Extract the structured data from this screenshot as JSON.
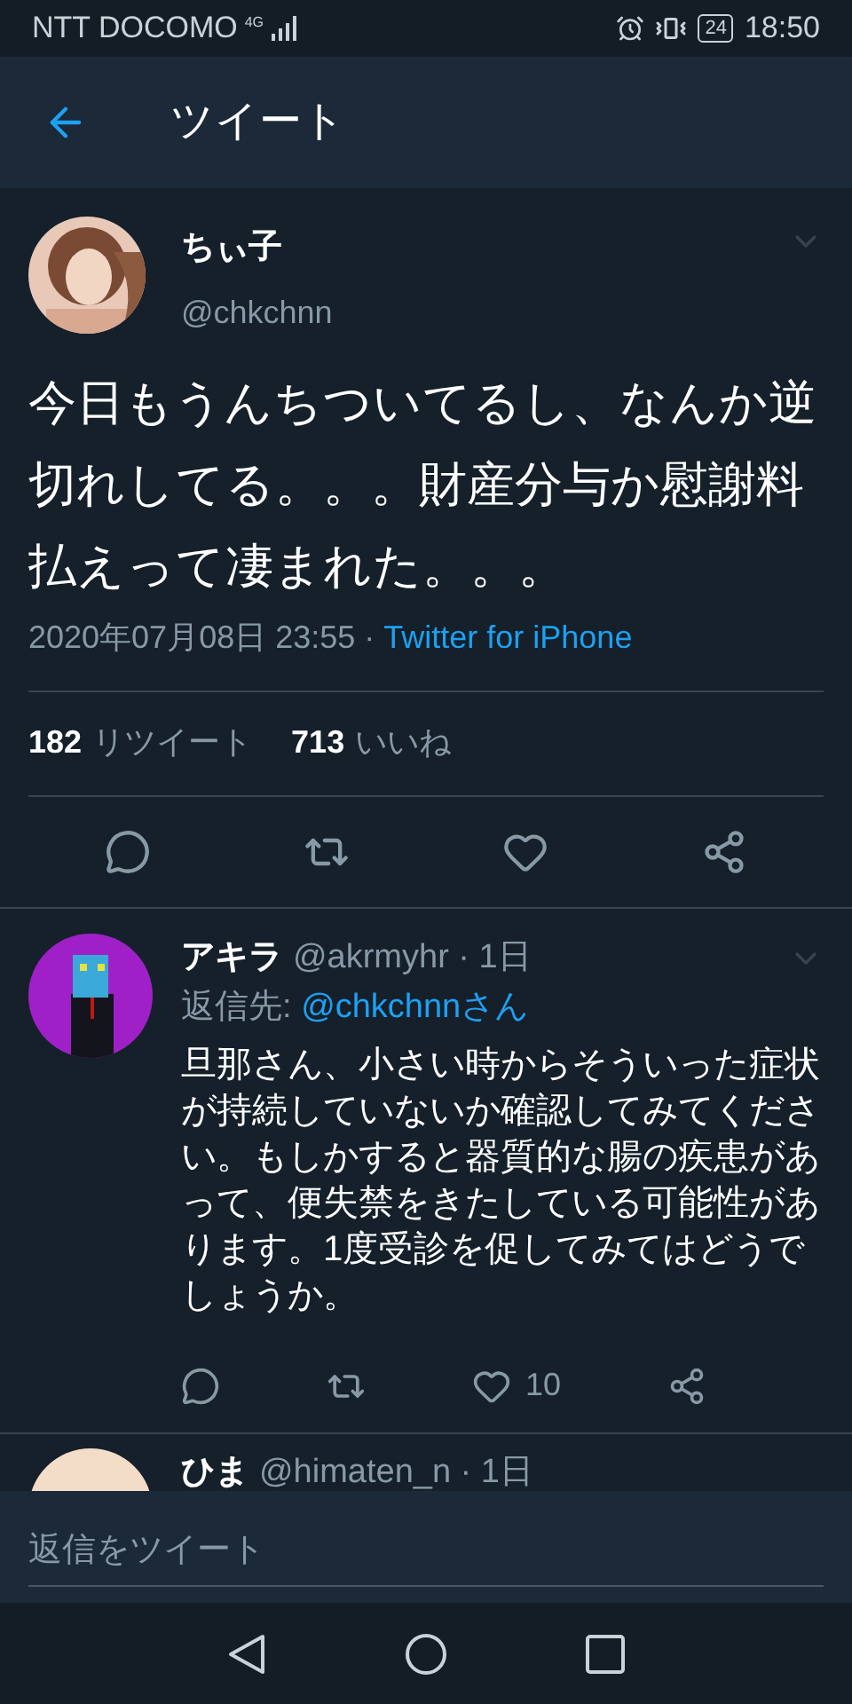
{
  "status_bar": {
    "carrier": "NTT DOCOMO",
    "network": "4G",
    "battery": "24",
    "time": "18:50"
  },
  "header": {
    "title": "ツイート"
  },
  "tweet": {
    "name": "ちぃ子",
    "handle": "@chkchnn",
    "text": "今日もうんちついてるし、なんか逆切れしてる。。。財産分与か慰謝料払えって凄まれた。。。",
    "timestamp": "2020年07月08日 23:55 · ",
    "source": "Twitter for iPhone",
    "stats": [
      {
        "count": "182",
        "label": "リツイート"
      },
      {
        "count": "713",
        "label": "いいね"
      }
    ]
  },
  "replies": [
    {
      "name": "アキラ",
      "handle": "@akrmyhr · 1日",
      "reply_to_label": "返信先: ",
      "reply_to": "@chkchnnさん",
      "text": "旦那さん、小さい時からそういった症状が持続していないか確認してみてください。もしかすると器質的な腸の疾患があって、便失禁をきたしている可能性があります。1度受診を促してみてはどうでしょうか。",
      "like_count": "10"
    },
    {
      "name": "ひま",
      "handle": "@himaten_n · 1日"
    }
  ],
  "reply_bar": {
    "placeholder": "返信をツイート"
  }
}
